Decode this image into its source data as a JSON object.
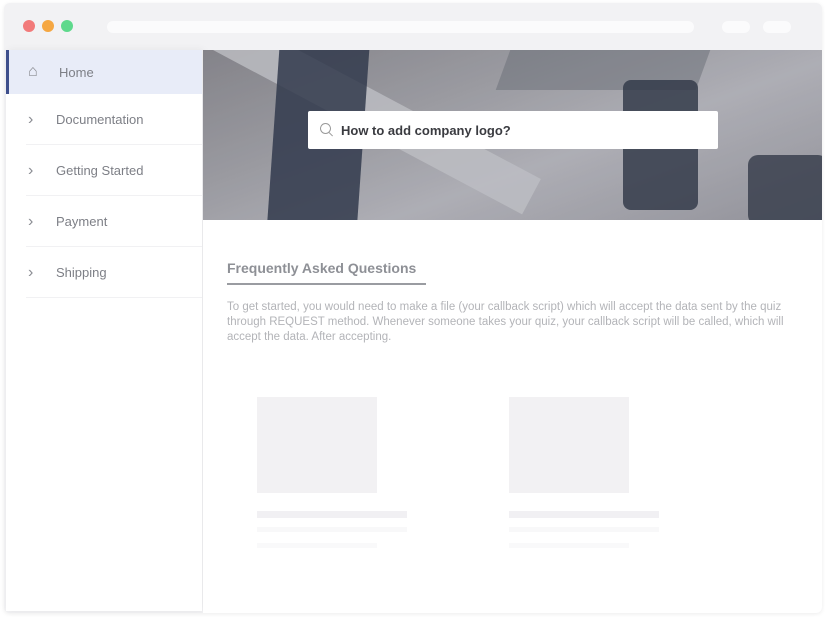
{
  "window": {
    "controls": {
      "close_color": "#f27a7a",
      "minimize_color": "#f5a742",
      "maximize_color": "#5ed98c"
    }
  },
  "sidebar": {
    "accent": "#3e4f8c",
    "items": [
      {
        "label": "Home",
        "icon": "home-icon",
        "active": true
      },
      {
        "label": "Documentation",
        "icon": "chevron-right-icon"
      },
      {
        "label": "Getting Started",
        "icon": "chevron-right-icon"
      },
      {
        "label": "Payment",
        "icon": "chevron-right-icon"
      },
      {
        "label": "Shipping",
        "icon": "chevron-right-icon"
      }
    ]
  },
  "hero": {
    "search_value": "How to add company logo?"
  },
  "faq": {
    "title": "Frequently Asked Questions",
    "text": "To get started, you would need to make a file (your callback script) which will accept the data sent by the quiz through REQUEST method. Whenever someone takes your quiz, your callback script will be called, which will accept the data. After accepting."
  }
}
